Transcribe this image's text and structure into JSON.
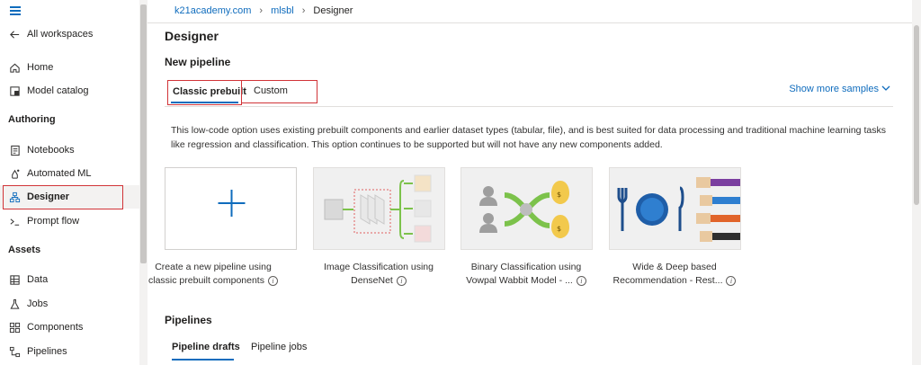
{
  "sidebar": {
    "all_workspaces": "All workspaces",
    "items_top": [
      {
        "label": "Home",
        "icon": "home-icon"
      },
      {
        "label": "Model catalog",
        "icon": "catalog-icon"
      }
    ],
    "section_authoring": "Authoring",
    "items_authoring": [
      {
        "label": "Notebooks",
        "icon": "notebook-icon"
      },
      {
        "label": "Automated ML",
        "icon": "automl-icon"
      },
      {
        "label": "Designer",
        "icon": "designer-icon"
      },
      {
        "label": "Prompt flow",
        "icon": "prompt-icon"
      }
    ],
    "section_assets": "Assets",
    "items_assets": [
      {
        "label": "Data",
        "icon": "data-icon"
      },
      {
        "label": "Jobs",
        "icon": "jobs-icon"
      },
      {
        "label": "Components",
        "icon": "components-icon"
      },
      {
        "label": "Pipelines",
        "icon": "pipelines-icon"
      }
    ]
  },
  "breadcrumb": {
    "items": [
      "k21academy.com",
      "mlsbl",
      "Designer"
    ]
  },
  "main": {
    "title": "Designer",
    "new_pipeline": "New pipeline",
    "tabs": [
      "Classic prebuilt",
      "Custom"
    ],
    "show_more": "Show more samples",
    "description": "This low-code option uses existing prebuilt components and earlier dataset types (tabular, file), and is best suited for data processing and traditional machine learning tasks like regression and classification. This option continues to be supported but will not have any new components added.",
    "cards": [
      {
        "line1": "Create a new pipeline using",
        "line2": "classic prebuilt components"
      },
      {
        "line1": "Image Classification using",
        "line2": "DenseNet"
      },
      {
        "line1": "Binary Classification using",
        "line2": "Vowpal Wabbit Model - ..."
      },
      {
        "line1": "Wide & Deep based",
        "line2": "Recommendation - Rest..."
      }
    ],
    "pipelines_title": "Pipelines",
    "pipeline_tabs": [
      "Pipeline drafts",
      "Pipeline jobs"
    ]
  },
  "colors": {
    "accent": "#0f6cbd",
    "highlight_box": "#d13438"
  }
}
